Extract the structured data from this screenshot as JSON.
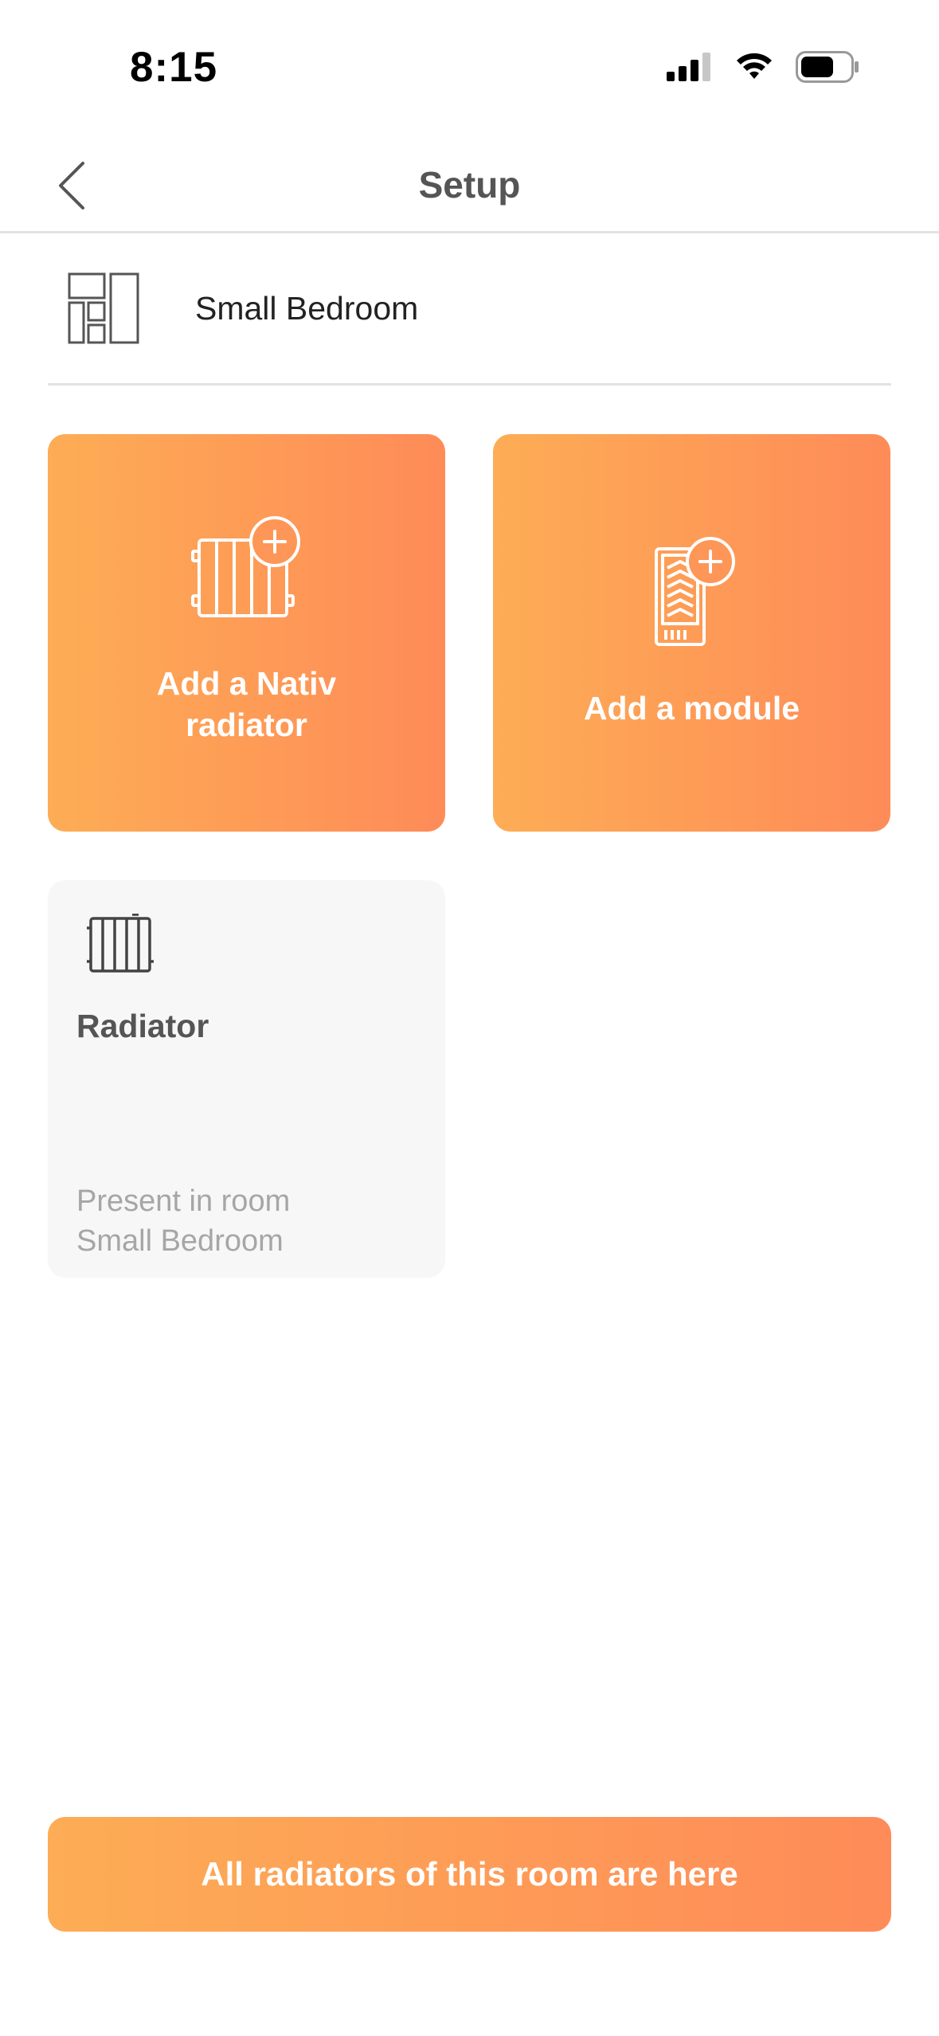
{
  "status_bar": {
    "time": "8:15",
    "icons": [
      "cellular-signal-icon",
      "wifi-icon",
      "battery-icon"
    ]
  },
  "header": {
    "title": "Setup",
    "back_icon": "chevron-left-icon"
  },
  "room": {
    "name": "Small Bedroom",
    "icon": "room-layout-icon"
  },
  "actions": [
    {
      "label_line1": "Add a Nativ",
      "label_line2": "radiator",
      "icon": "radiator-add-icon"
    },
    {
      "label": "Add a module",
      "icon": "module-add-icon"
    }
  ],
  "devices": [
    {
      "name": "Radiator",
      "status_line1": "Present in room",
      "status_line2": "Small Bedroom",
      "icon": "radiator-icon"
    }
  ],
  "footer": {
    "button_label": "All radiators of this room are here"
  },
  "colors": {
    "gradient_start": "#fdad55",
    "gradient_end": "#fe8b58",
    "card_bg": "#f7f7f7",
    "title_text": "#555555"
  }
}
